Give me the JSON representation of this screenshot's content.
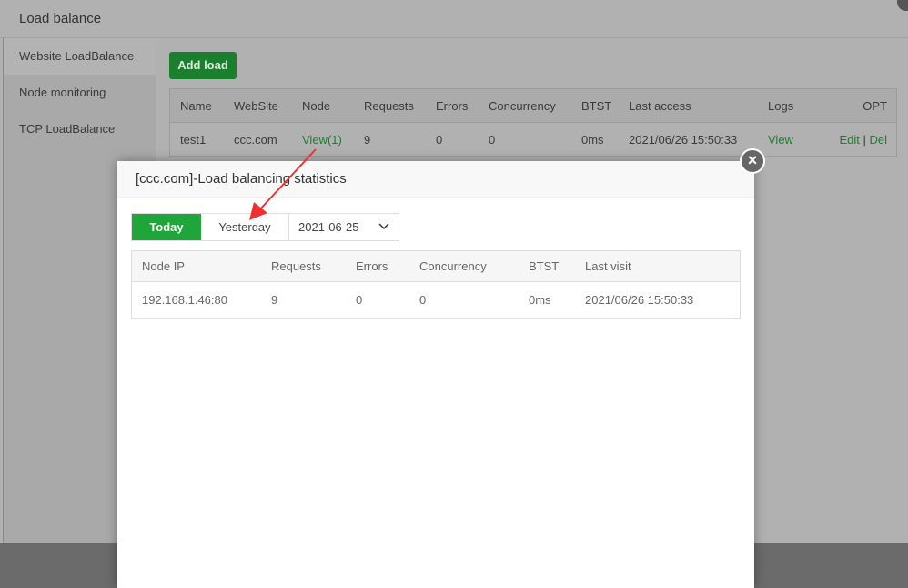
{
  "outer": {
    "title": "Load balance",
    "sidebar": [
      "Website LoadBalance",
      "Node monitoring",
      "TCP LoadBalance"
    ],
    "add_load": "Add load",
    "table": {
      "headers": [
        "Name",
        "WebSite",
        "Node",
        "Requests",
        "Errors",
        "Concurrency",
        "BTST",
        "Last access",
        "Logs",
        "OPT"
      ],
      "row": {
        "name": "test1",
        "website": "ccc.com",
        "node": "View(1)",
        "requests": "9",
        "errors": "0",
        "concurrency": "0",
        "btst": "0ms",
        "last_access": "2021/06/26 15:50:33",
        "logs": "View",
        "edit": "Edit",
        "sep": "|",
        "del": "Del"
      }
    }
  },
  "modal": {
    "title": "[ccc.com]-Load balancing statistics",
    "close": "×",
    "today": "Today",
    "yesterday": "Yesterday",
    "date": "2021-06-25",
    "chevron": "⌄",
    "table": {
      "headers": [
        "Node IP",
        "Requests",
        "Errors",
        "Concurrency",
        "BTST",
        "Last visit"
      ],
      "row": [
        "192.168.1.46:80",
        "9",
        "0",
        "0",
        "0ms",
        "2021/06/26 15:50:33"
      ]
    }
  },
  "colors": {
    "accent": "#20a53a",
    "link": "#1b7f2d",
    "annotation": "#f03030"
  }
}
